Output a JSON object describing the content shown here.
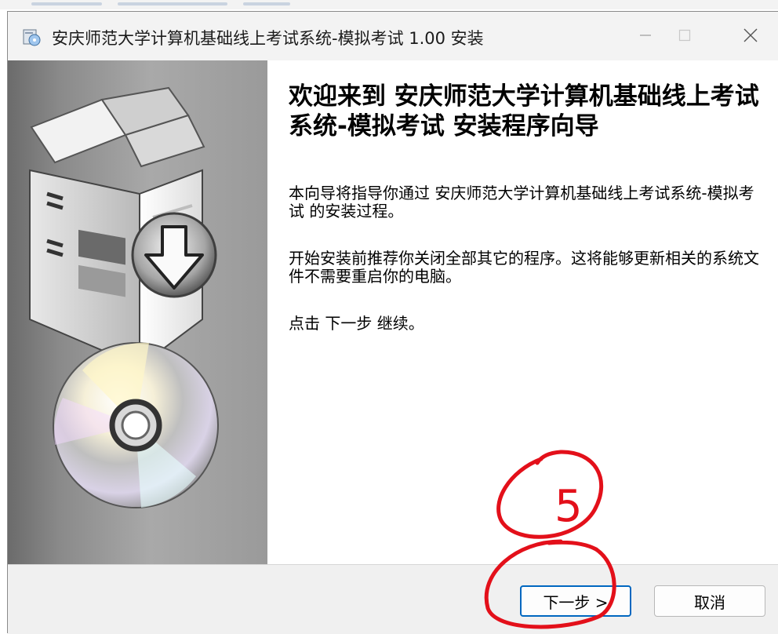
{
  "window": {
    "title": "安庆师范大学计算机基础线上考试系统-模拟考试 1.00 安装"
  },
  "welcome": {
    "heading": "欢迎来到 安庆师范大学计算机基础线上考试系统-模拟考试 安装程序向导",
    "paragraphs": [
      "本向导将指导你通过 安庆师范大学计算机基础线上考试系统-模拟考试 的安装过程。",
      "开始安装前推荐你关闭全部其它的程序。这将能够更新相关的系统文件不需要重启你的电脑。",
      "点击 下一步 继续。"
    ]
  },
  "buttons": {
    "next": "下一步 >",
    "cancel": "取消"
  },
  "annotation": {
    "label": "5",
    "color": "#e3101a"
  },
  "icons": [
    "installer-icon",
    "minimize-icon",
    "maximize-icon",
    "close-icon",
    "box-download-icon",
    "cd-disc-icon"
  ]
}
